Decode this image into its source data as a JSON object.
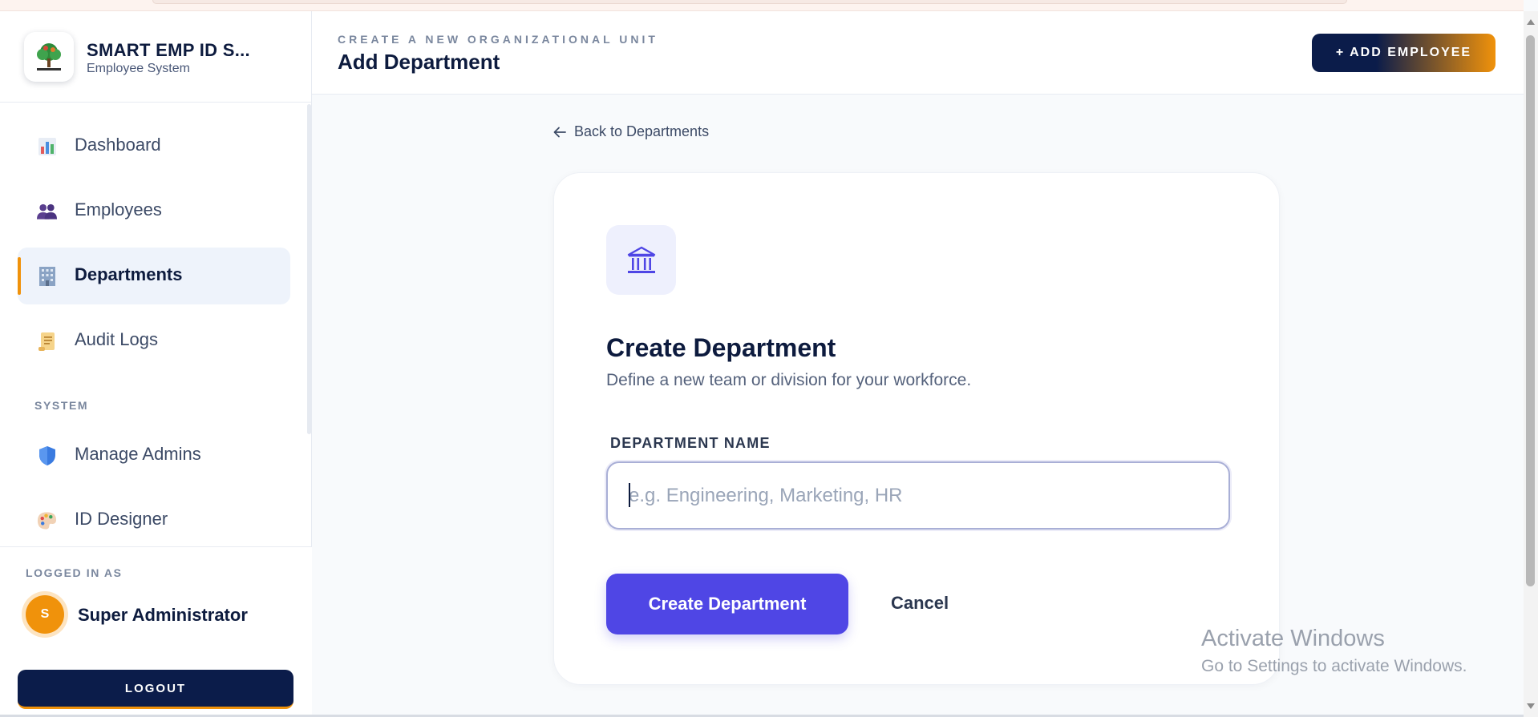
{
  "brand": {
    "title": "SMART EMP ID S...",
    "subtitle": "Employee System"
  },
  "sidebar": {
    "items": [
      {
        "label": "Dashboard",
        "icon": "bar-chart-icon",
        "active": false
      },
      {
        "label": "Employees",
        "icon": "people-icon",
        "active": false
      },
      {
        "label": "Departments",
        "icon": "office-building-icon",
        "active": true
      },
      {
        "label": "Audit Logs",
        "icon": "scroll-icon",
        "active": false
      }
    ],
    "section_label": "SYSTEM",
    "system_items": [
      {
        "label": "Manage Admins",
        "icon": "shield-icon"
      },
      {
        "label": "ID Designer",
        "icon": "palette-icon"
      }
    ]
  },
  "user": {
    "logged_in_label": "LOGGED IN AS",
    "avatar_initial": "S",
    "name": "Super Administrator",
    "logout_label": "LOGOUT"
  },
  "header": {
    "eyebrow": "CREATE A NEW ORGANIZATIONAL UNIT",
    "title": "Add Department",
    "add_employee_label": "+ ADD EMPLOYEE"
  },
  "main": {
    "back_label": "Back to Departments",
    "card_title": "Create Department",
    "card_subtitle": "Define a new team or division for your workforce.",
    "field_label": "DEPARTMENT NAME",
    "field_placeholder": "e.g. Engineering, Marketing, HR",
    "field_value": "",
    "create_label": "Create Department",
    "cancel_label": "Cancel"
  },
  "watermark": {
    "title": "Activate Windows",
    "subtitle": "Go to Settings to activate Windows."
  },
  "colors": {
    "navy": "#0b1c4a",
    "accent_orange": "#f0920b",
    "primary_indigo": "#4f46e5",
    "active_nav_bg": "#eef3fb"
  }
}
